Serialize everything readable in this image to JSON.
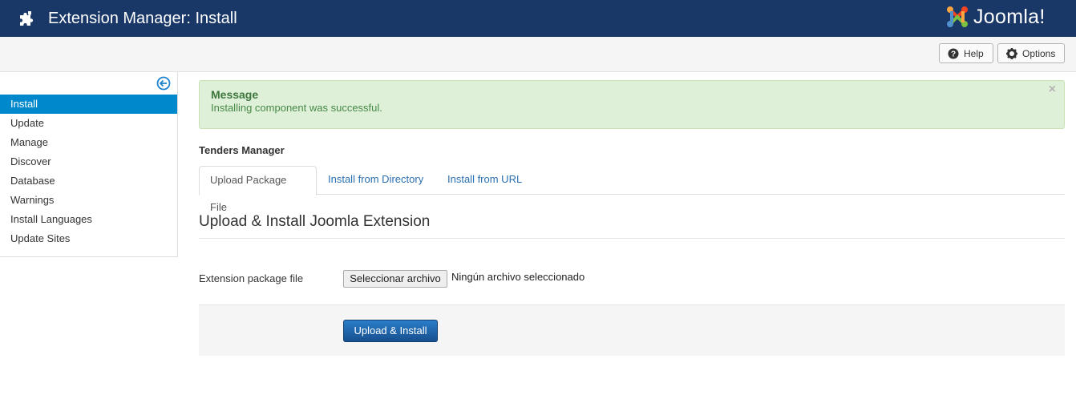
{
  "header": {
    "title": "Extension Manager: Install",
    "logo_text": "Joomla!",
    "icon": "puzzle-icon"
  },
  "toolbar": {
    "help_label": "Help",
    "options_label": "Options"
  },
  "sidebar": {
    "collapse_icon": "arrow-left-circle-icon",
    "items": [
      {
        "label": "Install",
        "active": true
      },
      {
        "label": "Update"
      },
      {
        "label": "Manage"
      },
      {
        "label": "Discover"
      },
      {
        "label": "Database"
      },
      {
        "label": "Warnings"
      },
      {
        "label": "Install Languages"
      },
      {
        "label": "Update Sites"
      }
    ]
  },
  "alert": {
    "heading": "Message",
    "text": "Installing component was successful.",
    "close": "×"
  },
  "section_title": "Tenders Manager",
  "tabs": [
    {
      "label": "Upload Package File",
      "active": true
    },
    {
      "label": "Install from Directory"
    },
    {
      "label": "Install from URL"
    }
  ],
  "form": {
    "legend": "Upload & Install Joomla Extension",
    "field_label": "Extension package file",
    "file_button": "Seleccionar archivo",
    "file_status": "Ningún archivo seleccionado",
    "submit_label": "Upload & Install"
  },
  "colors": {
    "header_bg": "#1a3867",
    "active_nav": "#0088cc",
    "alert_bg": "#dff0d8",
    "primary_btn": "#17508f"
  }
}
